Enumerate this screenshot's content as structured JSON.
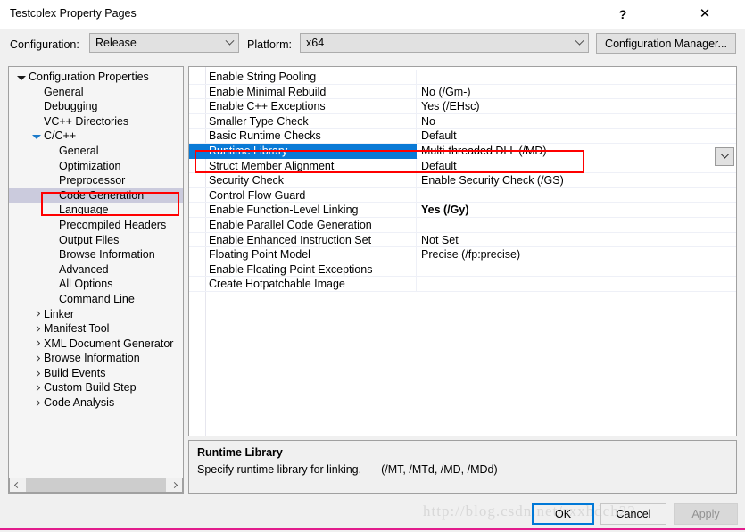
{
  "window": {
    "title": "Testcplex Property Pages",
    "help_glyph": "?",
    "close_glyph": "✕"
  },
  "config_bar": {
    "configuration_label": "Configuration:",
    "configuration_value": "Release",
    "platform_label": "Platform:",
    "platform_value": "x64",
    "configuration_manager_label": "Configuration Manager..."
  },
  "tree": {
    "items": [
      {
        "label": "Configuration Properties",
        "indent": 0,
        "expander": "open",
        "selected": false
      },
      {
        "label": "General",
        "indent": 1,
        "expander": "none",
        "selected": false
      },
      {
        "label": "Debugging",
        "indent": 1,
        "expander": "none",
        "selected": false
      },
      {
        "label": "VC++ Directories",
        "indent": 1,
        "expander": "none",
        "selected": false
      },
      {
        "label": "C/C++",
        "indent": 1,
        "expander": "open",
        "selected": false
      },
      {
        "label": "General",
        "indent": 2,
        "expander": "none",
        "selected": false
      },
      {
        "label": "Optimization",
        "indent": 2,
        "expander": "none",
        "selected": false
      },
      {
        "label": "Preprocessor",
        "indent": 2,
        "expander": "none",
        "selected": false
      },
      {
        "label": "Code Generation",
        "indent": 2,
        "expander": "none",
        "selected": true
      },
      {
        "label": "Language",
        "indent": 2,
        "expander": "none",
        "selected": false
      },
      {
        "label": "Precompiled Headers",
        "indent": 2,
        "expander": "none",
        "selected": false
      },
      {
        "label": "Output Files",
        "indent": 2,
        "expander": "none",
        "selected": false
      },
      {
        "label": "Browse Information",
        "indent": 2,
        "expander": "none",
        "selected": false
      },
      {
        "label": "Advanced",
        "indent": 2,
        "expander": "none",
        "selected": false
      },
      {
        "label": "All Options",
        "indent": 2,
        "expander": "none",
        "selected": false
      },
      {
        "label": "Command Line",
        "indent": 2,
        "expander": "none",
        "selected": false
      },
      {
        "label": "Linker",
        "indent": 1,
        "expander": "closed",
        "selected": false
      },
      {
        "label": "Manifest Tool",
        "indent": 1,
        "expander": "closed",
        "selected": false
      },
      {
        "label": "XML Document Generator",
        "indent": 1,
        "expander": "closed",
        "selected": false
      },
      {
        "label": "Browse Information",
        "indent": 1,
        "expander": "closed",
        "selected": false
      },
      {
        "label": "Build Events",
        "indent": 1,
        "expander": "closed",
        "selected": false
      },
      {
        "label": "Custom Build Step",
        "indent": 1,
        "expander": "closed",
        "selected": false
      },
      {
        "label": "Code Analysis",
        "indent": 1,
        "expander": "closed",
        "selected": false
      }
    ]
  },
  "grid": {
    "rows": [
      {
        "name": "Enable String Pooling",
        "value": "",
        "selected": false,
        "bold": false
      },
      {
        "name": "Enable Minimal Rebuild",
        "value": "No (/Gm-)",
        "selected": false,
        "bold": false
      },
      {
        "name": "Enable C++ Exceptions",
        "value": "Yes (/EHsc)",
        "selected": false,
        "bold": false
      },
      {
        "name": "Smaller Type Check",
        "value": "No",
        "selected": false,
        "bold": false
      },
      {
        "name": "Basic Runtime Checks",
        "value": "Default",
        "selected": false,
        "bold": false
      },
      {
        "name": "Runtime Library",
        "value": "Multi-threaded DLL (/MD)",
        "selected": true,
        "bold": false
      },
      {
        "name": "Struct Member Alignment",
        "value": "Default",
        "selected": false,
        "bold": false
      },
      {
        "name": "Security Check",
        "value": "Enable Security Check (/GS)",
        "selected": false,
        "bold": false
      },
      {
        "name": "Control Flow Guard",
        "value": "",
        "selected": false,
        "bold": false
      },
      {
        "name": "Enable Function-Level Linking",
        "value": "Yes (/Gy)",
        "selected": false,
        "bold": true
      },
      {
        "name": "Enable Parallel Code Generation",
        "value": "",
        "selected": false,
        "bold": false
      },
      {
        "name": "Enable Enhanced Instruction Set",
        "value": "Not Set",
        "selected": false,
        "bold": false
      },
      {
        "name": "Floating Point Model",
        "value": "Precise (/fp:precise)",
        "selected": false,
        "bold": false
      },
      {
        "name": "Enable Floating Point Exceptions",
        "value": "",
        "selected": false,
        "bold": false
      },
      {
        "name": "Create Hotpatchable Image",
        "value": "",
        "selected": false,
        "bold": false
      }
    ]
  },
  "description": {
    "title": "Runtime Library",
    "text": "Specify runtime library for linking.",
    "args": "(/MT, /MTd, /MD, /MDd)"
  },
  "footer": {
    "ok_label": "OK",
    "cancel_label": "Cancel",
    "apply_label": "Apply"
  },
  "watermark": {
    "text": "http://blog.csdn.net/rxxhdch23"
  },
  "colors": {
    "selection_blue": "#0a7ad6",
    "tree_selection": "#cbcbdd",
    "annotation_red": "#ff0000",
    "accent_border": "#0078d7",
    "bottom_rule": "#e21c8d"
  }
}
